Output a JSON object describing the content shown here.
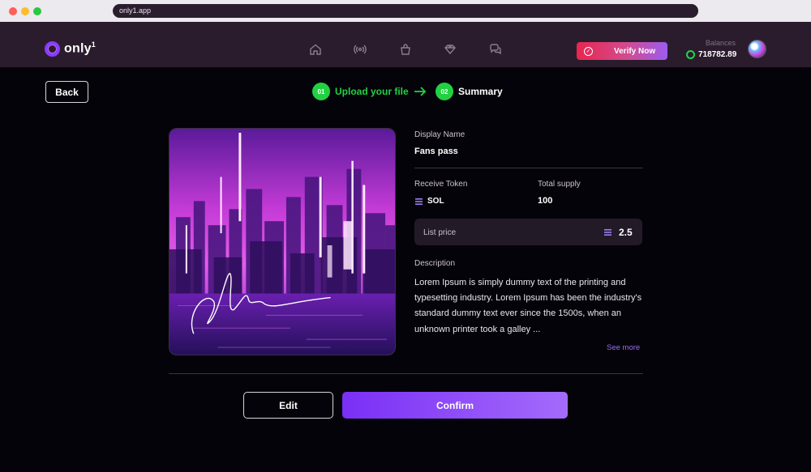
{
  "browser": {
    "url": "only1.app"
  },
  "header": {
    "logo_text": "only",
    "logo_sup": "1",
    "nav_icons": [
      "home-icon",
      "broadcast-icon",
      "bag-icon",
      "diamond-icon",
      "chat-icon"
    ],
    "verify_label": "Verify Now",
    "balances_label": "Balances",
    "balance_value": "718782.89"
  },
  "page": {
    "back_label": "Back",
    "steps": [
      {
        "num": "01",
        "label": "Upload your file",
        "status": "done"
      },
      {
        "num": "02",
        "label": "Summary",
        "status": "active"
      }
    ]
  },
  "details": {
    "display_name_label": "Display Name",
    "display_name": "Fans pass",
    "receive_token_label": "Receive Token",
    "receive_token": "SOL",
    "total_supply_label": "Total supply",
    "total_supply": "100",
    "list_price_label": "List price",
    "list_price": "2.5",
    "description_label": "Description",
    "description": "Lorem Ipsum is simply dummy text of the printing and typesetting industry. Lorem Ipsum has been the industry's standard dummy text ever since the 1500s, when an unknown printer took a galley ...",
    "see_more": "See more"
  },
  "actions": {
    "edit_label": "Edit",
    "confirm_label": "Confirm"
  },
  "colors": {
    "accent_green": "#22d142",
    "accent_purple": "#8a3cff",
    "verify_red": "#e8264e"
  }
}
